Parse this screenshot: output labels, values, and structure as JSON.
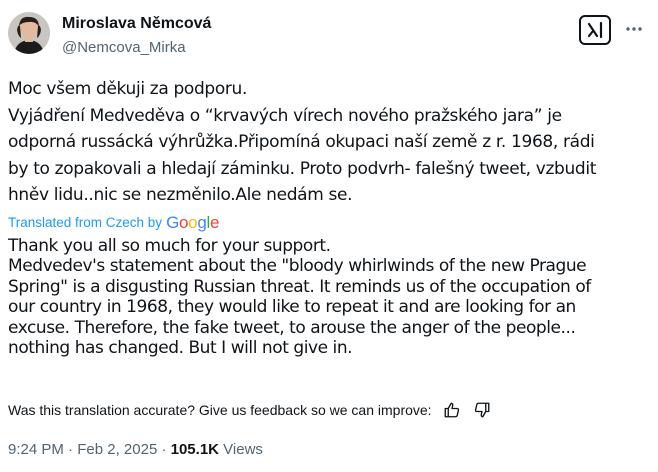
{
  "author": {
    "display_name": "Miroslava Němcová",
    "handle": "@Nemcova_Mirka",
    "avatar_icon": "profile-photo"
  },
  "header": {
    "grok_icon": "grok-icon",
    "more_icon": "more-options-icon"
  },
  "original_text": {
    "lines": [
      "Moc všem děkuji za podporu.",
      "Vyjádření Medveděva o “krvavých vírech nového pražského jara” je",
      "odporná russácká výhrůžka.Připomíná okupaci naší země z r. 1968, rádi",
      "by to zopakovali a hledají záminku. Proto podvrh- falešný tweet, vzbudit",
      "hněv lidu..nic se nezměnilo.Ale nedám se."
    ]
  },
  "translation_notice": {
    "label": "Translated from Czech by",
    "provider": "Google"
  },
  "translated_text": {
    "lines": [
      "Thank you all so much for your support.",
      "Medvedev's statement about the \"bloody whirlwinds of the new Prague",
      "Spring\" is a disgusting Russian threat. It reminds us of the occupation of",
      "our country in 1968, they would like to repeat it and are looking for an",
      "excuse. Therefore, the fake tweet, to arouse the anger of the people...",
      "nothing has changed. But I will not give in."
    ]
  },
  "feedback": {
    "prompt": "Was this translation accurate? Give us feedback so we can improve:",
    "thumbs_up_icon": "thumbs-up-icon",
    "thumbs_down_icon": "thumbs-down-icon"
  },
  "meta": {
    "time": "9:24 PM",
    "separator": " · ",
    "date": "Feb 2, 2025",
    "views_separator": " · ",
    "views_count": "105.1K",
    "views_label": " Views"
  },
  "colors": {
    "text_primary": "#0f1419",
    "text_secondary": "#536471",
    "link_blue": "#1d9bf0"
  }
}
